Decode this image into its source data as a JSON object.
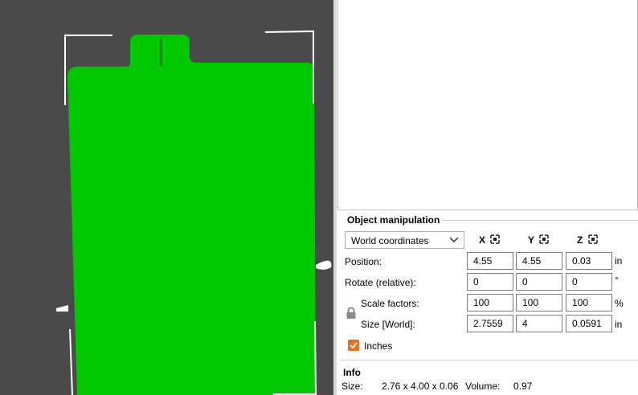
{
  "object_manipulation": {
    "title": "Object manipulation",
    "coordinate_mode": "World coordinates",
    "axes": [
      "X",
      "Y",
      "Z"
    ],
    "rows": [
      {
        "label": "Position:",
        "values": [
          "4.55",
          "4.55",
          "0.03"
        ],
        "unit": "in"
      },
      {
        "label": "Rotate (relative):",
        "values": [
          "0",
          "0",
          "0"
        ],
        "unit": "°"
      },
      {
        "label": "Scale factors:",
        "values": [
          "100",
          "100",
          "100"
        ],
        "unit": "%"
      },
      {
        "label": "Size [World]:",
        "values": [
          "2.7559",
          "4",
          "0.0591"
        ],
        "unit": "in"
      }
    ],
    "inches_label": "Inches",
    "inches_checked": true
  },
  "info": {
    "title": "Info",
    "size_label": "Size:",
    "size_value": "2.76 x 4.00 x 0.06",
    "volume_label": "Volume:",
    "volume_value": "0.97"
  },
  "colors": {
    "model": "#00c800",
    "viewport_bg": "#4a4a4a",
    "accent": "#e8701e"
  }
}
